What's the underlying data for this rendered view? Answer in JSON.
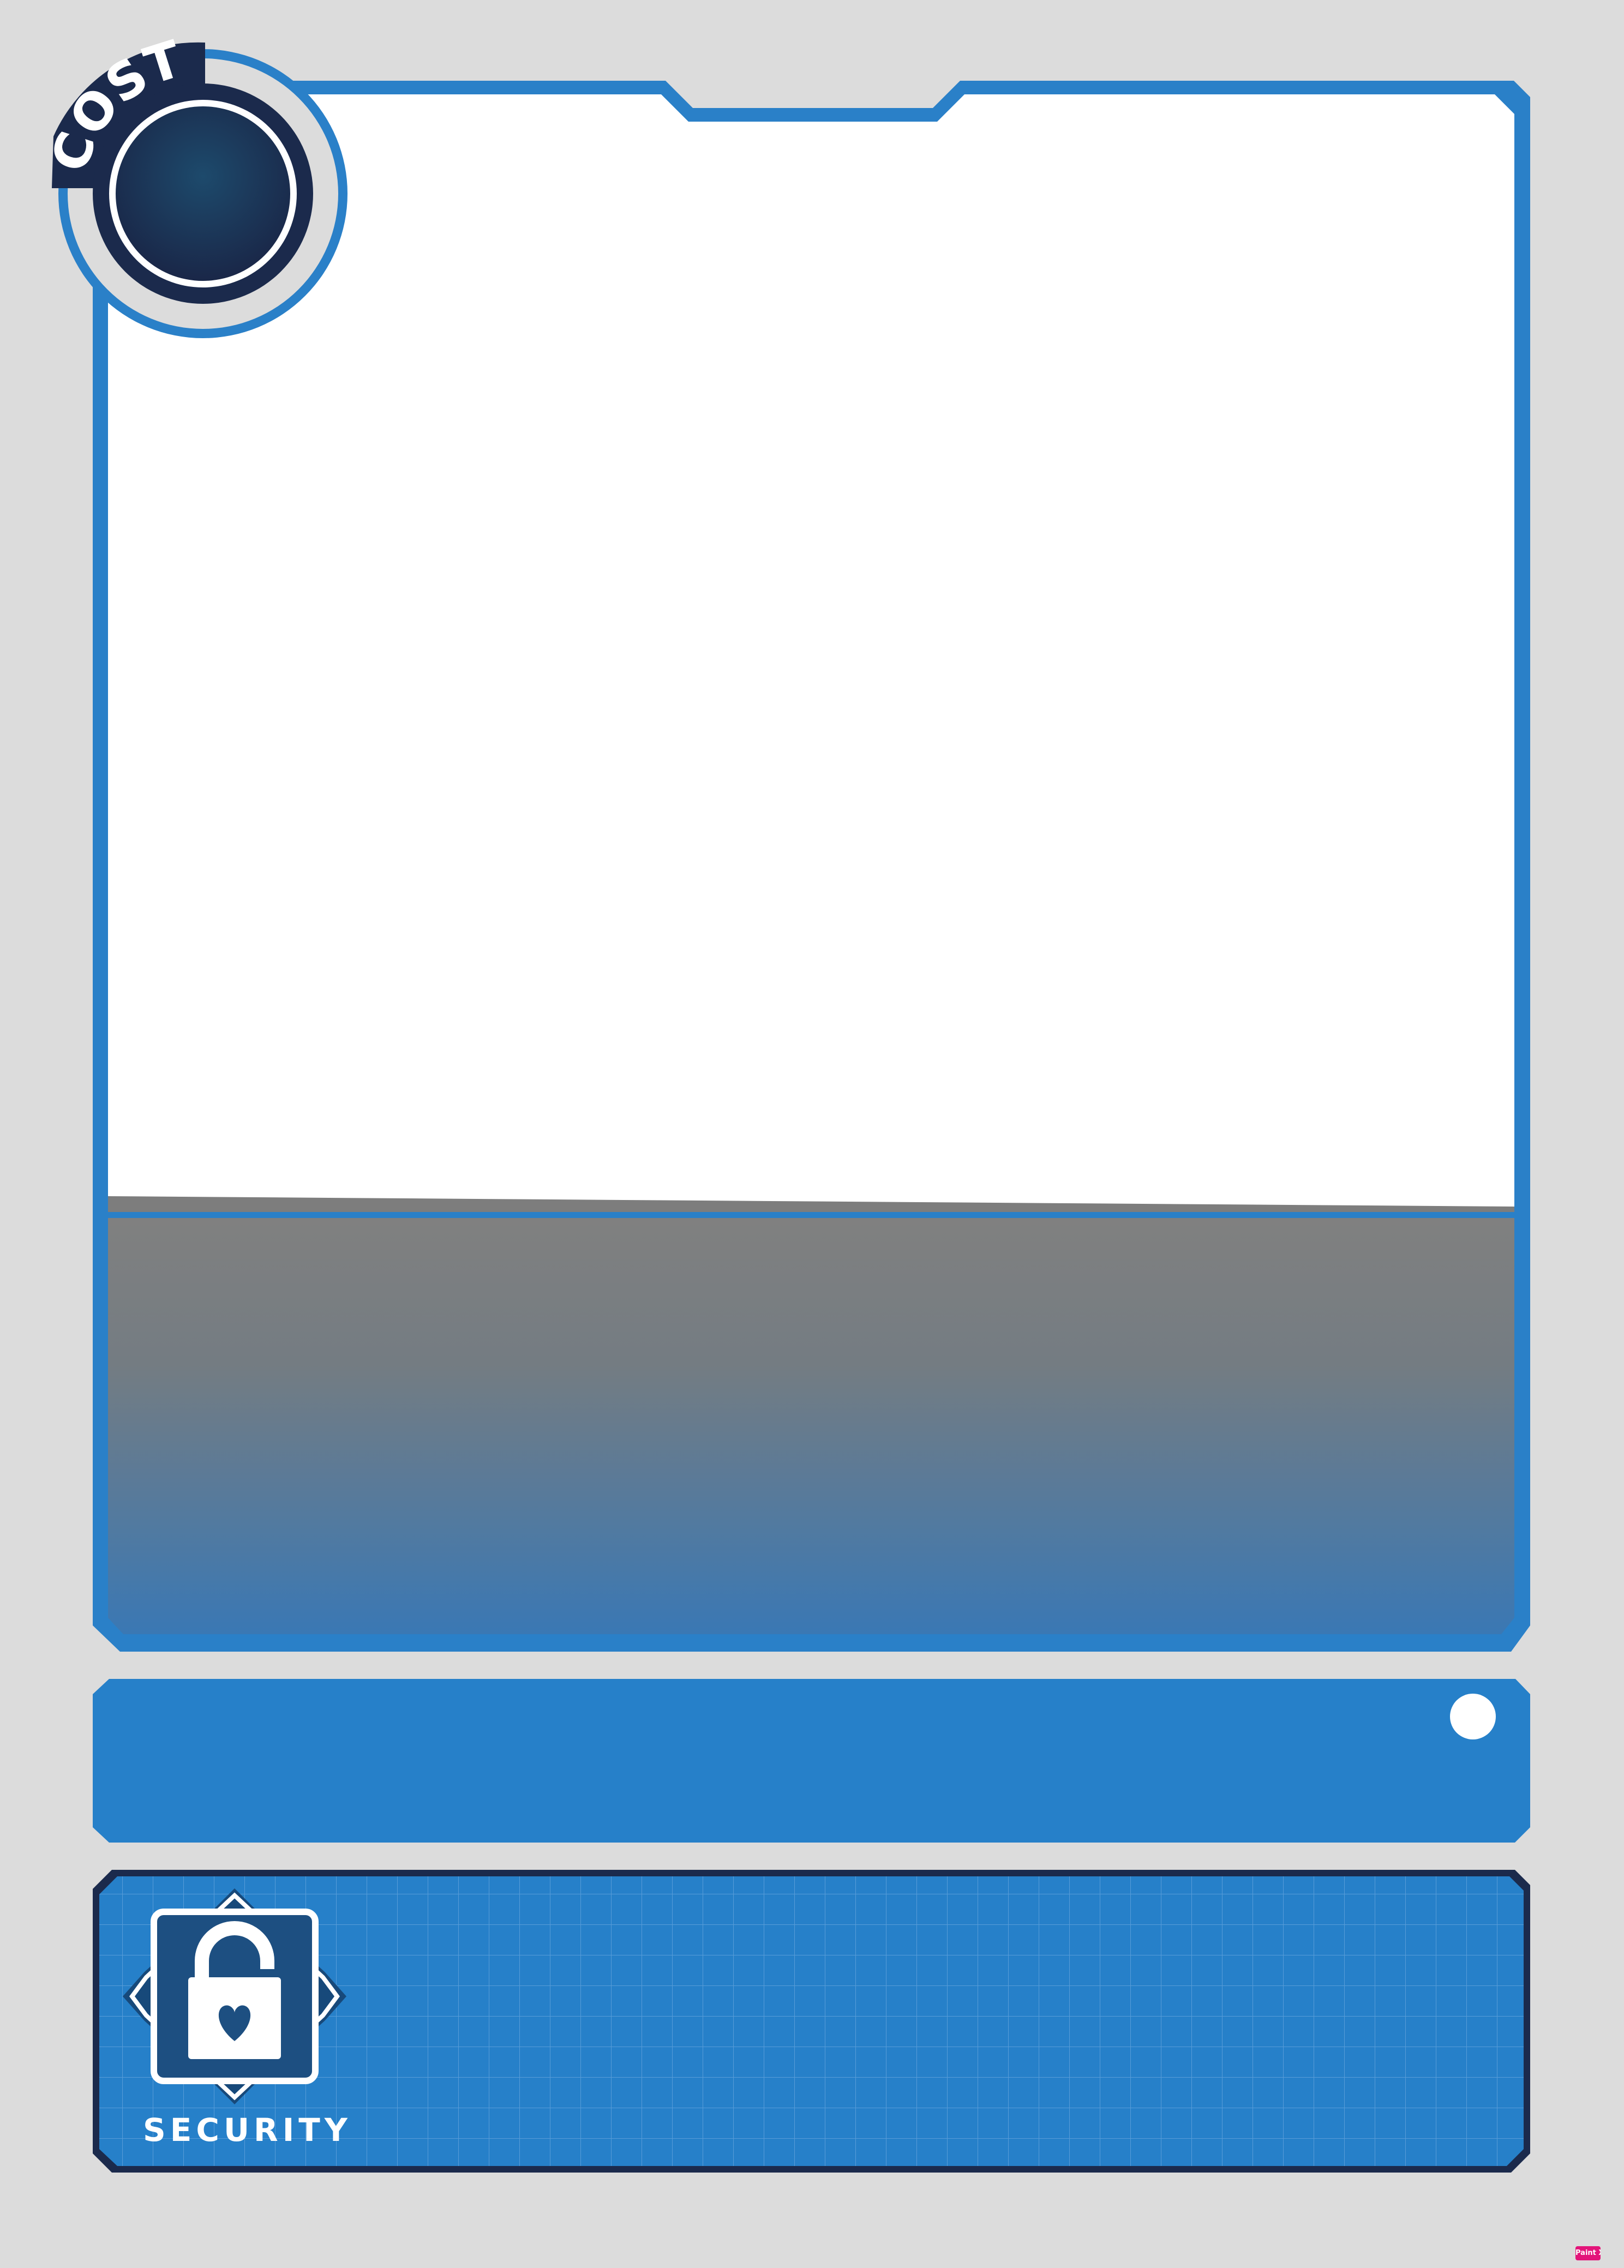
{
  "card": {
    "cost_label": "COST",
    "security_label": "SECURITY",
    "watermark_text": "Paint X"
  },
  "colors": {
    "background": "#dcdcdc",
    "frame_blue": "#2a80c8",
    "name_bar_blue": "#2680c9",
    "cost_navy": "#1b2a4c",
    "text_box_top": "#808080",
    "text_box_bottom": "#3a78b4",
    "security_icon_navy": "#17497a"
  },
  "icons": {
    "cost_badge": "cost-gem-icon",
    "security": "padlock-heart-icon",
    "name_bar_dot": "circle-icon"
  }
}
